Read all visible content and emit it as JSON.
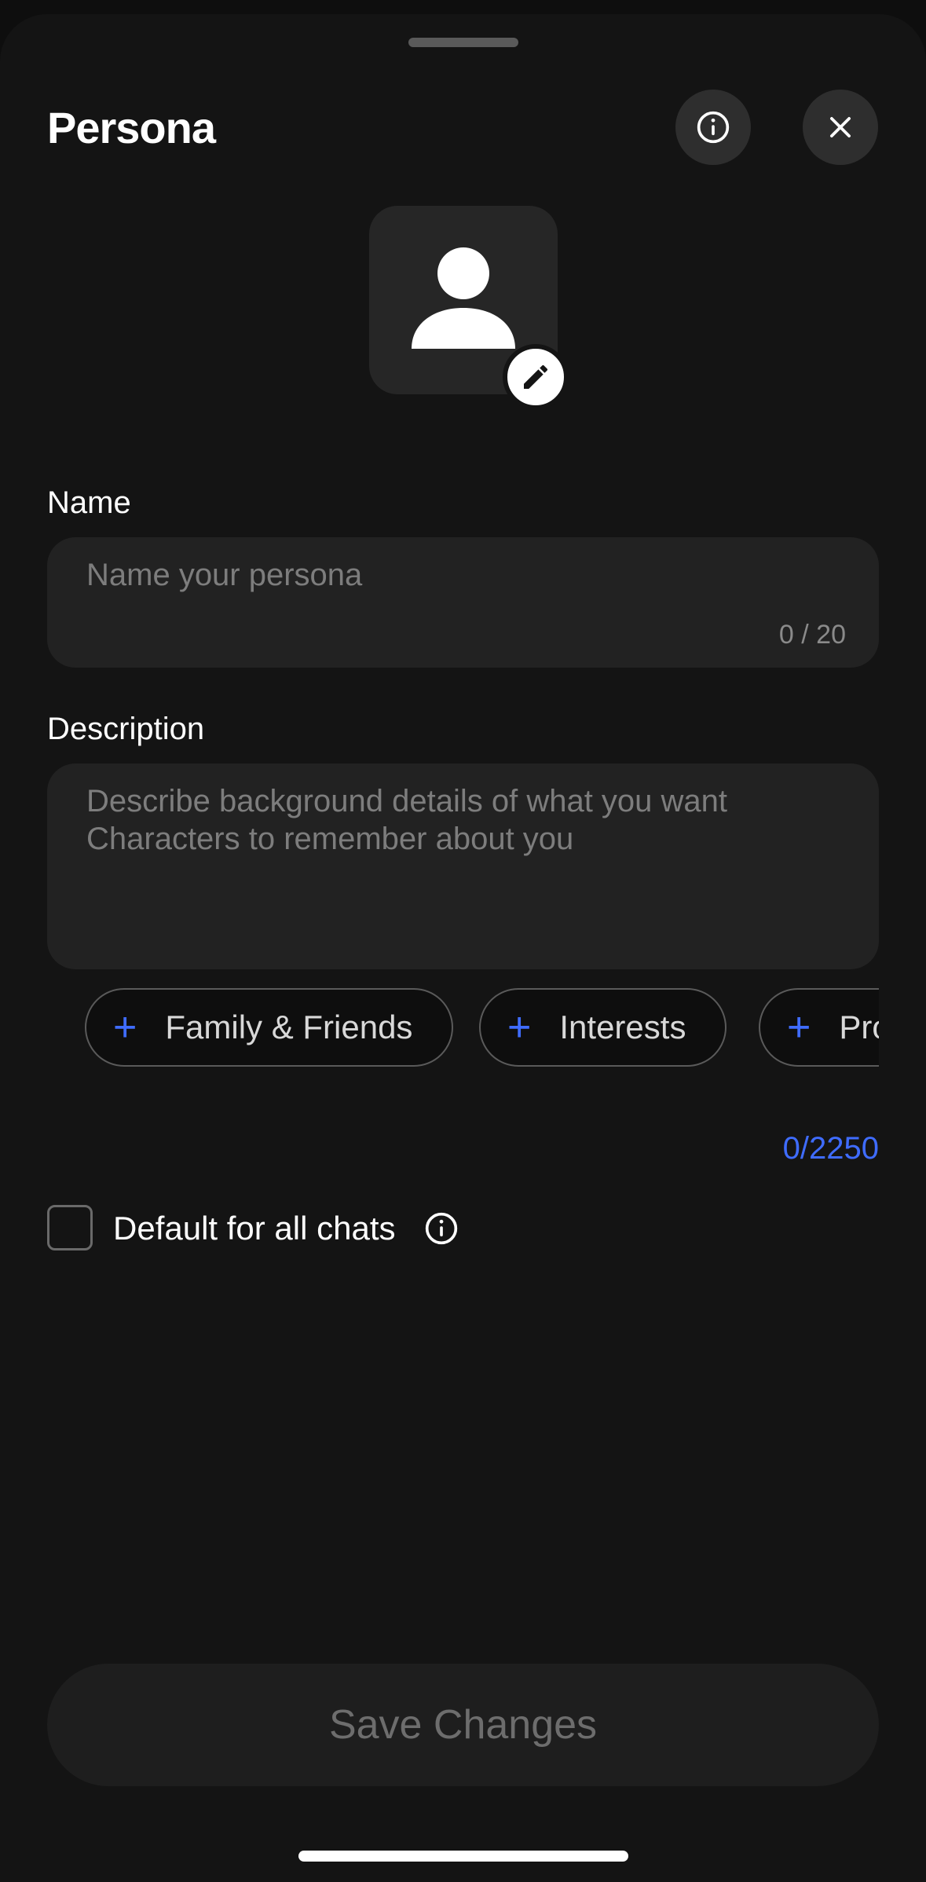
{
  "header": {
    "title": "Persona"
  },
  "icons": {
    "info": "info-icon",
    "close": "close-icon",
    "avatar": "person-icon",
    "edit": "pencil-icon",
    "chip": "plus-icon"
  },
  "name_field": {
    "label": "Name",
    "placeholder": "Name your persona",
    "value": "",
    "counter": "0 / 20"
  },
  "description_field": {
    "label": "Description",
    "placeholder": "Describe background details of what you want Characters to remember about you",
    "value": "",
    "counter": "0/2250"
  },
  "chips": [
    {
      "label": "Family & Friends"
    },
    {
      "label": "Interests"
    },
    {
      "label": "Pro"
    }
  ],
  "default_toggle": {
    "label": "Default for all chats",
    "checked": false
  },
  "footer": {
    "save_label": "Save Changes"
  },
  "colors": {
    "accent": "#3f6cff",
    "background": "#141414",
    "field": "#222222"
  }
}
